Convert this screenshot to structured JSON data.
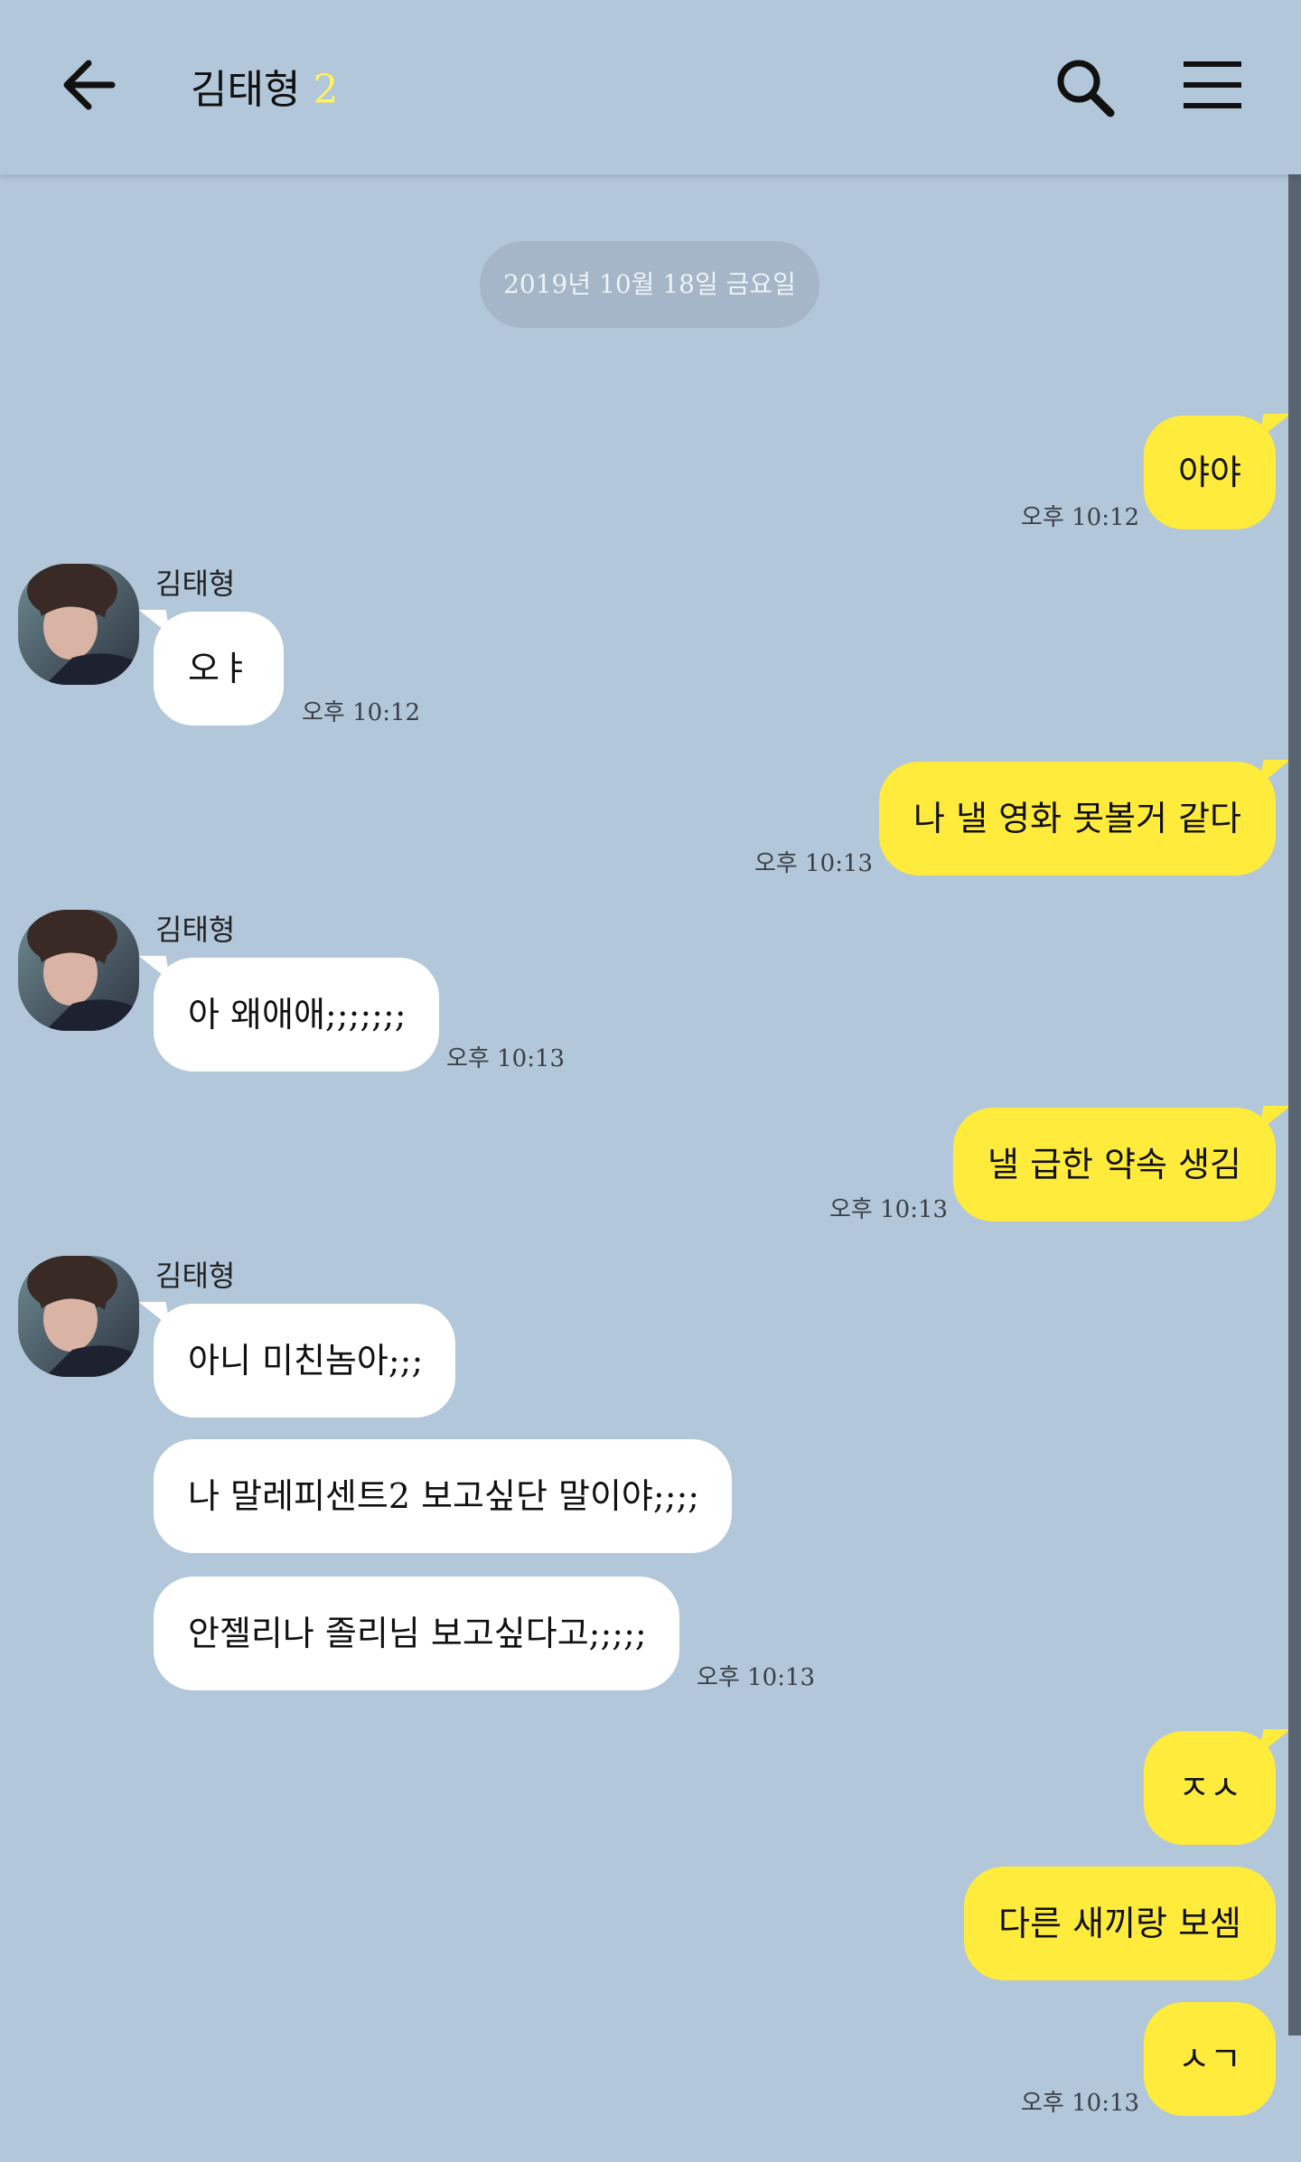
{
  "header": {
    "title": "김태형",
    "member_count": "2"
  },
  "date_divider": "2019년 10월 18일 금요일",
  "messages": [
    {
      "text": "야야",
      "time": "오후 10:12"
    },
    {
      "sender": "김태형",
      "text": "오ㅑ",
      "time": "오후 10:12"
    },
    {
      "text": "나 낼 영화 못볼거 같다",
      "time": "오후 10:13"
    },
    {
      "sender": "김태형",
      "text": "아 왜애애;;;;;;;",
      "time": "오후 10:13"
    },
    {
      "text": "낼 급한 약속 생김",
      "time": "오후 10:13"
    },
    {
      "sender": "김태형",
      "text": "아니 미친놈아;;;"
    },
    {
      "text": "나 말레피센트2 보고싶단 말이야;;;;"
    },
    {
      "text": "안젤리나 졸리님 보고싶다고;;;;;",
      "time": "오후 10:13"
    },
    {
      "text": "ㅈㅅ"
    },
    {
      "text": "다른 새끼랑 보셈"
    },
    {
      "text": "ㅅㄱ",
      "time": "오후 10:13"
    }
  ],
  "icons": {
    "back": "arrow-left-icon",
    "search": "search-icon",
    "menu": "hamburger-menu-icon",
    "avatar": "profile-photo"
  },
  "colors": {
    "background": "#b2c7da",
    "outgoing_bubble": "#ffeb3b",
    "incoming_bubble": "#ffffff",
    "member_count": "#fff35a"
  }
}
